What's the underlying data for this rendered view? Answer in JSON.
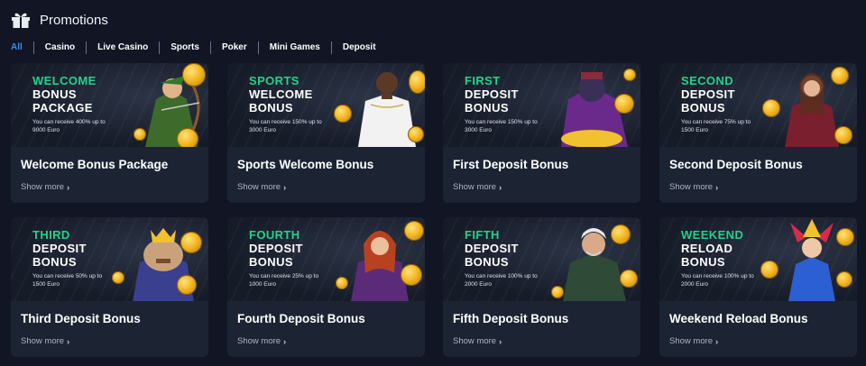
{
  "header": {
    "title": "Promotions",
    "icon": "gift-icon"
  },
  "filters": [
    "All",
    "Casino",
    "Live Casino",
    "Sports",
    "Poker",
    "Mini Games",
    "Deposit"
  ],
  "colors": {
    "accent": "#3e8de6",
    "banner_green": "#25d18b",
    "card_bg": "#1c2433",
    "page_bg": "#111524"
  },
  "cards": [
    {
      "banner": [
        "WELCOME",
        "BONUS",
        "PACKAGE"
      ],
      "banner_desc": "You can receive 400% up to 9000 Euro",
      "title": "Welcome Bonus Package",
      "more": "Show more",
      "art": "archer-character"
    },
    {
      "banner": [
        "SPORTS",
        "WELCOME",
        "BONUS"
      ],
      "banner_desc": "You can receive 150% up to 3000 Euro",
      "title": "Sports Welcome Bonus",
      "more": "Show more",
      "art": "football-player"
    },
    {
      "banner": [
        "FIRST",
        "DEPOSIT",
        "BONUS"
      ],
      "banner_desc": "You can receive 150% up to 3000 Euro",
      "title": "First Deposit Bonus",
      "more": "Show more",
      "art": "gorilla-character"
    },
    {
      "banner": [
        "SECOND",
        "DEPOSIT",
        "BONUS"
      ],
      "banner_desc": "You can receive 75% up to 1500 Euro",
      "title": "Second Deposit Bonus",
      "more": "Show more",
      "art": "woman-character"
    },
    {
      "banner": [
        "THIRD",
        "DEPOSIT",
        "BONUS"
      ],
      "banner_desc": "You can receive 50% up to 1500 Euro",
      "title": "Third Deposit Bonus",
      "more": "Show more",
      "art": "bulldog-king"
    },
    {
      "banner": [
        "FOURTH",
        "DEPOSIT",
        "BONUS"
      ],
      "banner_desc": "You can receive 25% up to 1000 Euro",
      "title": "Fourth Deposit Bonus",
      "more": "Show more",
      "art": "redhead-character"
    },
    {
      "banner": [
        "FIFTH",
        "DEPOSIT",
        "BONUS"
      ],
      "banner_desc": "You can receive 100% up to 2000 Euro",
      "title": "Fifth Deposit Bonus",
      "more": "Show more",
      "art": "old-man-character"
    },
    {
      "banner": [
        "WEEKEND",
        "RELOAD",
        "BONUS"
      ],
      "banner_desc": "You can receive 100% up to 2000 Euro",
      "title": "Weekend Reload Bonus",
      "more": "Show more",
      "art": "jester-character"
    }
  ]
}
